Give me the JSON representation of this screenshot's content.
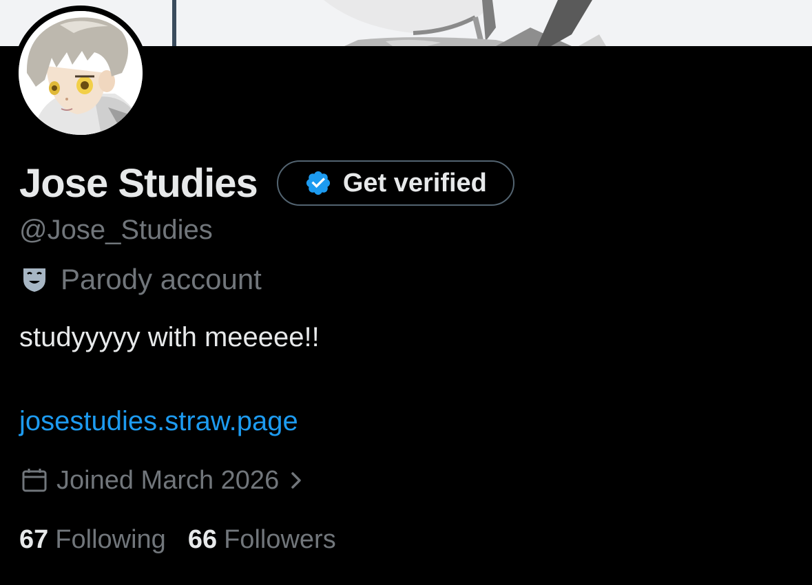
{
  "profile": {
    "display_name": "Jose Studies",
    "handle": "@Jose_Studies",
    "account_label": "Parody account",
    "bio": "studyyyyy with meeeee!!",
    "website": "josestudies.straw.page",
    "joined": "Joined March 2026",
    "following_count": "67",
    "following_label": "Following",
    "followers_count": "66",
    "followers_label": "Followers"
  },
  "verify_button": {
    "label": "Get verified"
  },
  "icons": {
    "verify": "verified-badge-icon",
    "parody": "theater-mask-icon",
    "calendar": "calendar-icon",
    "chevron": "chevron-right-icon"
  },
  "colors": {
    "background": "#000000",
    "text_primary": "#e7e9ea",
    "text_secondary": "#71767b",
    "link": "#1d9bf0",
    "verified_blue": "#1d9bf0",
    "button_border": "#536471"
  }
}
